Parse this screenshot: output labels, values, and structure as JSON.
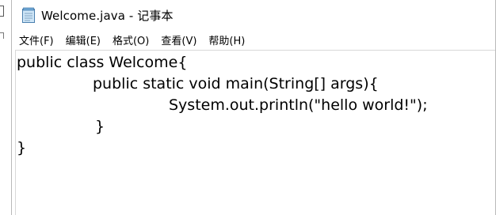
{
  "window": {
    "title": "Welcome.java - 记事本",
    "icon": "notepad-icon"
  },
  "menubar": {
    "items": [
      {
        "label": "文件(F)"
      },
      {
        "label": "编辑(E)"
      },
      {
        "label": "格式(O)"
      },
      {
        "label": "查看(V)"
      },
      {
        "label": "帮助(H)"
      }
    ]
  },
  "editor": {
    "lines": [
      "public class Welcome{",
      "public static void main(String[] args){",
      "System.out.println(\"hello world!\");",
      "}",
      "}"
    ]
  }
}
